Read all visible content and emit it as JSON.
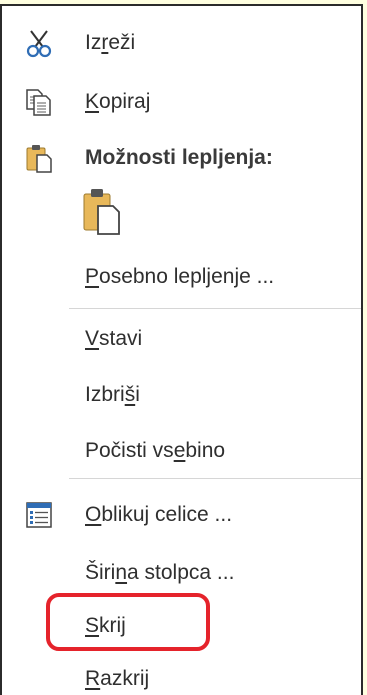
{
  "menu": {
    "cut": {
      "pre": "Iz",
      "key": "r",
      "post": "eži"
    },
    "copy": {
      "pre": "",
      "key": "K",
      "post": "opiraj"
    },
    "paste_options_label": "Možnosti lepljenja:",
    "paste_special": {
      "pre": "",
      "key": "P",
      "post": "osebno lepljenje ..."
    },
    "insert": {
      "pre": "",
      "key": "V",
      "post": "stavi"
    },
    "delete": {
      "pre": "Izbri",
      "key": "š",
      "post": "i"
    },
    "clear_contents": {
      "pre": "Počisti vs",
      "key": "e",
      "post": "bino"
    },
    "format_cells": {
      "pre": "",
      "key": "O",
      "post": "blikuj celice ..."
    },
    "column_width": {
      "pre": "Širi",
      "key": "n",
      "post": "a stolpca ..."
    },
    "hide": {
      "pre": "",
      "key": "S",
      "post": "krij"
    },
    "unhide": {
      "pre": "",
      "key": "R",
      "post": "azkrij"
    }
  },
  "icons": {
    "cut": "scissors-icon",
    "copy": "copy-icon",
    "paste_options": "clipboard-icon",
    "paste_default": "paste-icon",
    "format_cells": "format-cells-icon"
  },
  "colors": {
    "highlight": "#e5232b",
    "background": "#ffffe0",
    "clipboard": "#e8b85a"
  }
}
